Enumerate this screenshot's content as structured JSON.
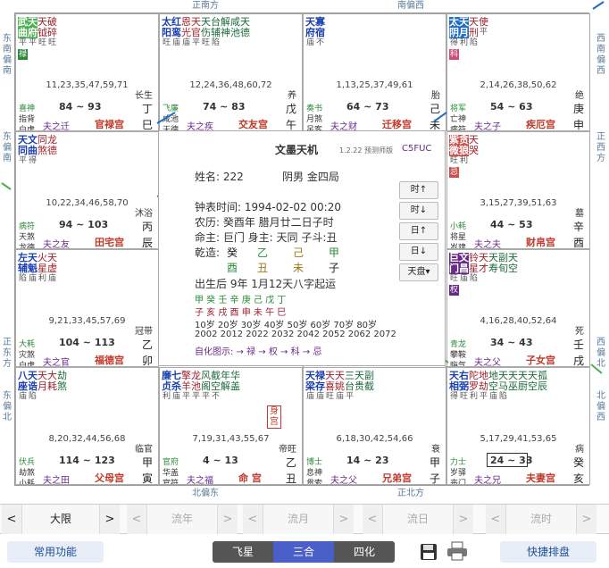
{
  "directions": {
    "top_left": "正南方",
    "top_right": "南偏西",
    "left_1": "东南偏南",
    "left_2": "东偏南",
    "left_3": "正东方",
    "left_4": "东偏北",
    "right_1": "西南偏西",
    "right_2": "正西方",
    "right_3": "西偏北",
    "right_4": "北偏西",
    "bottom_left": "北偏东",
    "bottom_right": "正北方"
  },
  "cells": [
    {
      "stars": [
        [
          "武",
          "平"
        ],
        [
          "天",
          "平"
        ],
        [
          "天",
          "旺"
        ],
        [
          "破",
          "旺"
        ]
      ],
      "stars2": [
        [
          "曲",
          "-"
        ],
        [
          "府",
          "-"
        ],
        [
          "钺",
          "-"
        ],
        [
          "碎",
          "陷"
        ]
      ],
      "names": [
        "武曲",
        "天府",
        "天钺",
        "破碎"
      ],
      "hua": "禄",
      "ages": "11,23,35,47,59,71",
      "state": "长生",
      "daxian": "84 ~ 93",
      "stem": "丁",
      "br1": "喜神",
      "br2": "指背",
      "br3": "白虎",
      "jiang": "夫之迁",
      "palace": "官禄宫",
      "branch": "巳"
    },
    {
      "stars": [
        [
          "太",
          "旺"
        ],
        [
          "红",
          "庙"
        ],
        [
          "恩",
          "庙"
        ],
        [
          "天",
          "平"
        ],
        [
          "天",
          "旺"
        ],
        [
          "台",
          "陷"
        ],
        [
          "解",
          "-"
        ],
        [
          "咸",
          "-"
        ],
        [
          "天",
          "-"
        ]
      ],
      "stars2": [
        [
          "阳",
          "-"
        ],
        [
          "鸾",
          "-"
        ],
        [
          "光",
          "-"
        ],
        [
          "官",
          "-"
        ],
        [
          "伤",
          "-"
        ],
        [
          "辅",
          "-"
        ],
        [
          "神",
          "-"
        ],
        [
          "池",
          "-"
        ],
        [
          "德",
          "-"
        ]
      ],
      "ages": "12,24,36,48,60,72",
      "state": "养",
      "daxian": "74 ~ 83",
      "stem": "戊",
      "br1": "飞廉",
      "br2": "咸池",
      "br3": "天德",
      "jiang": "夫之疾",
      "palace": "交友宫",
      "branch": "午"
    },
    {
      "stars": [
        [
          "天",
          "庙"
        ],
        [
          "寡",
          "不"
        ]
      ],
      "stars2": [
        [
          "府",
          "-"
        ],
        [
          "宿",
          "-"
        ]
      ],
      "ages": "1,13,25,37,49,61",
      "state": "胎",
      "daxian": "64 ~ 73",
      "stem": "己",
      "br1": "奏书",
      "br2": "月煞",
      "br3": "吊客",
      "jiang": "夫之财",
      "palace": "迁移宫",
      "branch": "未"
    },
    {
      "stars": [
        [
          "太",
          "得"
        ],
        [
          "天",
          "利"
        ],
        [
          "天",
          "陷"
        ],
        [
          "-",
          "平"
        ]
      ],
      "stars2": [
        [
          "阴",
          "-"
        ],
        [
          "月",
          "-"
        ],
        [
          "刑",
          "-"
        ],
        [
          "使",
          "-"
        ]
      ],
      "hua": "科",
      "ages": "2,14,26,38,50,62",
      "state": "绝",
      "daxian": "54 ~ 63",
      "stem": "庚",
      "br1": "将军",
      "br2": "亡神",
      "br3": "病符",
      "jiang": "夫之子",
      "palace": "疾厄宫",
      "branch": "申"
    },
    {
      "stars": [
        [
          "天",
          "平"
        ],
        [
          "文",
          "得"
        ],
        [
          "同",
          "-"
        ],
        [
          "龙",
          "-"
        ]
      ],
      "stars2": [
        [
          "同",
          "-"
        ],
        [
          "曲",
          "-"
        ],
        [
          "煞",
          "-"
        ],
        [
          "德",
          "-"
        ]
      ],
      "ages": "10,22,34,46,58,70",
      "state": "沐浴",
      "daxian": "94 ~ 103",
      "stem": "丙",
      "br1": "病符",
      "br2": "天煞",
      "br3": "龙德",
      "jiang": "夫之友",
      "palace": "田宅宫",
      "branch": "辰"
    },
    {
      "stars": [
        [
          "紫",
          "旺"
        ],
        [
          "贪",
          "利"
        ],
        [
          "天",
          "-"
        ]
      ],
      "stars2": [
        [
          "微",
          "-"
        ],
        [
          "狼",
          "-"
        ],
        [
          "哭",
          "-"
        ]
      ],
      "hua": "忌",
      "ages": "3,15,27,39,51,63",
      "state": "墓",
      "daxian": "44 ~ 53",
      "stem": "辛",
      "br1": "小耗",
      "br2": "将星",
      "br3": "岁建",
      "jiang": "夫之夫",
      "palace": "财帛宫",
      "branch": "酉"
    },
    {
      "stars": [
        [
          "左",
          "陷"
        ],
        [
          "天",
          "庙"
        ],
        [
          "火",
          "利"
        ],
        [
          "天",
          "庙"
        ]
      ],
      "stars2": [
        [
          "辅",
          "-"
        ],
        [
          "魁",
          "-"
        ],
        [
          "星",
          "-"
        ],
        [
          "虚",
          "-"
        ]
      ],
      "ages": "9,21,33,45,57,69",
      "state": "冠带",
      "daxian": "104 ~ 113",
      "stem": "乙",
      "br1": "大耗",
      "br2": "灾煞",
      "br3": "白虎",
      "jiang": "夫之官",
      "palace": "福德宫",
      "branch": "卯"
    },
    {
      "stars": [
        [
          "巨",
          "旺"
        ],
        [
          "文",
          "庙"
        ],
        [
          "铃",
          "陷"
        ],
        [
          "天",
          "-"
        ],
        [
          "天",
          "-"
        ],
        [
          "副",
          "-"
        ],
        [
          "天",
          "-"
        ]
      ],
      "stars2": [
        [
          "门",
          "-"
        ],
        [
          "昌",
          "-"
        ],
        [
          "星",
          "-"
        ],
        [
          "才",
          "-"
        ],
        [
          "寿",
          "-"
        ],
        [
          "旬",
          "-"
        ],
        [
          "空",
          "-"
        ]
      ],
      "hua": "权",
      "ages": "4,16,28,40,52,64",
      "state": "死",
      "daxian": "34 ~ 43",
      "stem": "壬",
      "br1": "青龙",
      "br2": "攀鞍",
      "br3": "晦气",
      "jiang": "夫之父",
      "palace": "子女宫",
      "branch": "戌"
    },
    {
      "stars": [
        [
          "八",
          "庙"
        ],
        [
          "天",
          "陷"
        ],
        [
          "天",
          "-"
        ],
        [
          "大",
          "-"
        ],
        [
          "劫",
          "-"
        ]
      ],
      "stars2": [
        [
          "座",
          "-"
        ],
        [
          "诰",
          "-"
        ],
        [
          "月",
          "-"
        ],
        [
          "耗",
          "-"
        ],
        [
          "煞",
          "-"
        ]
      ],
      "ages": "8,20,32,44,56,68",
      "state": "临官",
      "daxian": "114 ~ 123",
      "stem": "甲",
      "br1": "伏兵",
      "br2": "劫煞",
      "br3": "小耗",
      "jiang": "夫之田",
      "palace": "父母宫",
      "branch": "寅"
    },
    {
      "stars": [
        [
          "廉",
          "利"
        ],
        [
          "七",
          "庙"
        ],
        [
          "擎",
          "平"
        ],
        [
          "龙",
          "平"
        ],
        [
          "风",
          "平"
        ],
        [
          "截",
          "不"
        ],
        [
          "年",
          "-"
        ],
        [
          "华",
          "-"
        ]
      ],
      "stars2": [
        [
          "贞",
          "-"
        ],
        [
          "杀",
          "-"
        ],
        [
          "羊",
          "-"
        ],
        [
          "池",
          "-"
        ],
        [
          "阁",
          "-"
        ],
        [
          "空",
          "-"
        ],
        [
          "解",
          "-"
        ],
        [
          "盖",
          "-"
        ]
      ],
      "ages": "7,19,31,43,55,67",
      "state": "帝旺",
      "daxian": "4 ~ 13",
      "stem": "乙",
      "br1": "官府",
      "br2": "华盖",
      "br3": "官符",
      "jiang": "夫之福",
      "palace": "命 宫",
      "branch": "丑",
      "badge": "身宫"
    },
    {
      "stars": [
        [
          "天",
          "庙"
        ],
        [
          "禄",
          "庙"
        ],
        [
          "天",
          "旺"
        ],
        [
          "天",
          "庙"
        ],
        [
          "三",
          "平"
        ],
        [
          "天",
          "-"
        ],
        [
          "副",
          "-"
        ]
      ],
      "stars2": [
        [
          "梁",
          "-"
        ],
        [
          "存",
          "-"
        ],
        [
          "喜",
          "-"
        ],
        [
          "姚",
          "-"
        ],
        [
          "台",
          "-"
        ],
        [
          "贵",
          "-"
        ],
        [
          "截",
          "-"
        ]
      ],
      "ages": "6,18,30,42,54,66",
      "state": "衰",
      "daxian": "14 ~ 23",
      "stem": "甲",
      "br1": "博士",
      "br2": "息神",
      "br3": "贯索",
      "jiang": "夫之父",
      "palace": "兄弟宫",
      "branch": "子"
    },
    {
      "stars": [
        [
          "天",
          "得"
        ],
        [
          "右",
          "旺"
        ],
        [
          "陀",
          "利"
        ],
        [
          "地",
          "平"
        ],
        [
          "地",
          "庙"
        ],
        [
          "天",
          "陷"
        ],
        [
          "天",
          "-"
        ],
        [
          "天",
          "-"
        ],
        [
          "天",
          "-"
        ],
        [
          "孤",
          "-"
        ]
      ],
      "stars2": [
        [
          "相",
          "-"
        ],
        [
          "弼",
          "-"
        ],
        [
          "罗",
          "-"
        ],
        [
          "劫",
          "-"
        ],
        [
          "空",
          "-"
        ],
        [
          "马",
          "-"
        ],
        [
          "巫",
          "-"
        ],
        [
          "厨",
          "-"
        ],
        [
          "空",
          "-"
        ],
        [
          "辰",
          "-"
        ]
      ],
      "ages": "5,17,29,41,53,65",
      "state": "病",
      "daxian": "24 ~ 33",
      "stem": "癸",
      "br1": "力士",
      "br2": "岁驿",
      "br3": "丧门",
      "jiang": "夫之兄",
      "palace": "夫妻宫",
      "branch": "亥"
    }
  ],
  "center": {
    "title": "文墨天机",
    "version": "1.2.22 预测师版",
    "code": "C5FUC",
    "name": "姓名: 222",
    "gender": "阴男 金四局",
    "clock": "钟表时间: 1994-02-02 00:20",
    "lunar": "农历: 癸酉年 腊月廿二日子时",
    "ming": "命主: 巨门 身主: 天同 子斗:丑",
    "qianzao_label": "乾造:",
    "pillars_top": [
      "癸",
      "乙",
      "己",
      "甲"
    ],
    "pillars_bottom": [
      "酉",
      "丑",
      "未",
      "子"
    ],
    "birth": "出生后 9年 1月12天八字起运",
    "dayun_stems": "甲 癸 壬 辛 庚 己 戊 丁",
    "dayun_branches": "子 亥 戌 酉 申 未 午 巳",
    "dayun_ages": "10岁 20岁 30岁 40岁 50岁 60岁 70岁 80岁",
    "dayun_years": "2002 2012 2022 2032 2042 2052 2062 2072",
    "legend": "自化图示: → 禄 → 权 → 科 → 忌",
    "buttons": [
      "时↑",
      "时↓",
      "日↑",
      "日↓",
      "天盘▾"
    ]
  },
  "nav": [
    {
      "label": "大限",
      "left": "<",
      "right": ">"
    },
    {
      "label": "流年",
      "left": "<",
      "right": ">"
    },
    {
      "label": "流月",
      "left": "<",
      "right": ">"
    },
    {
      "label": "流日",
      "left": "<",
      "right": ">"
    },
    {
      "label": "流时",
      "left": "<",
      "right": ">"
    }
  ],
  "bottom": {
    "common": "常用功能",
    "feixing": "飞星",
    "sanhe": "三合",
    "sihua": "四化",
    "quick": "快捷排盘"
  },
  "colors": {
    "accent_blue": "#1e6ec9",
    "seg_dark": "#555555",
    "seg_active": "#4a5fc7"
  }
}
